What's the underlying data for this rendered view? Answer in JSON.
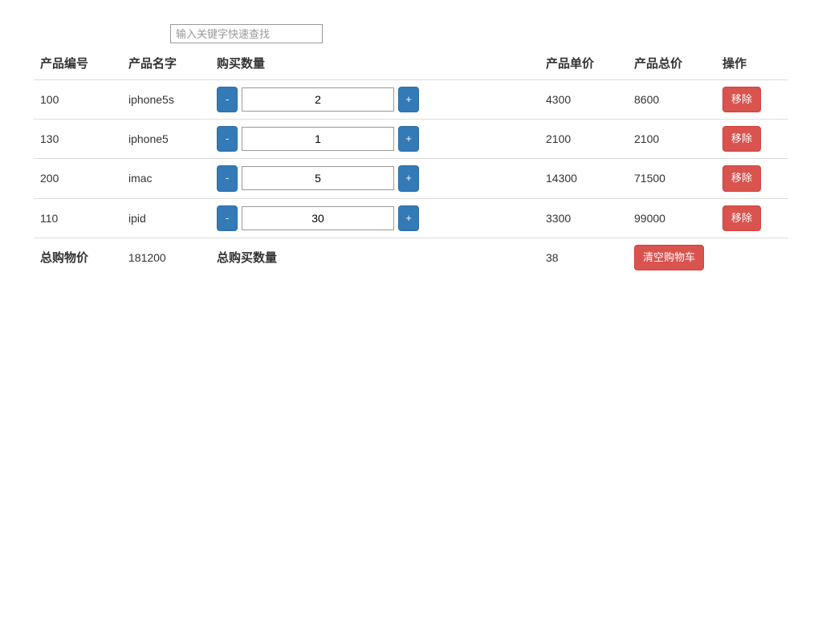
{
  "search": {
    "placeholder": "输入关键字快速查找"
  },
  "headers": {
    "id": "产品编号",
    "name": "产品名字",
    "qty": "购买数量",
    "price": "产品单价",
    "total": "产品总价",
    "action": "操作"
  },
  "buttons": {
    "minus": "-",
    "plus": "+",
    "remove": "移除",
    "clear": "清空购物车"
  },
  "rows": [
    {
      "id": "100",
      "name": "iphone5s",
      "qty": "2",
      "price": "4300",
      "total": "8600"
    },
    {
      "id": "130",
      "name": "iphone5",
      "qty": "1",
      "price": "2100",
      "total": "2100"
    },
    {
      "id": "200",
      "name": "imac",
      "qty": "5",
      "price": "14300",
      "total": "71500"
    },
    {
      "id": "110",
      "name": "ipid",
      "qty": "30",
      "price": "3300",
      "total": "99000"
    }
  ],
  "summary": {
    "total_price_label": "总购物价",
    "total_price_value": "181200",
    "total_qty_label": "总购买数量",
    "total_qty_value": "38"
  }
}
